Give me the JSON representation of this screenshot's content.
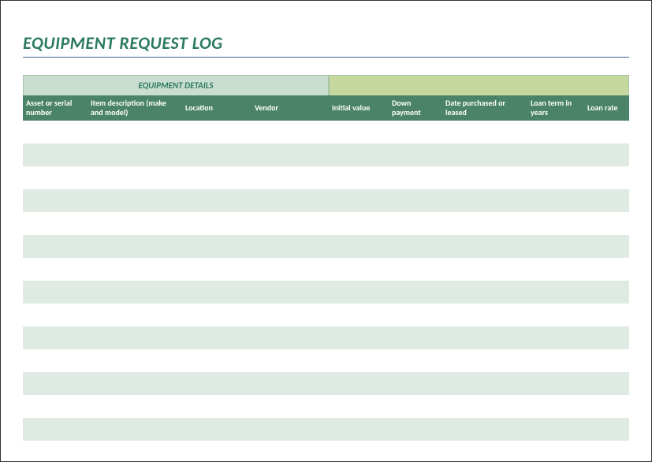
{
  "title": "EQUIPMENT REQUEST LOG",
  "tabs": {
    "left": "EQUIPMENT DETAILS",
    "right": ""
  },
  "columns": [
    "Asset or serial number",
    "Item description (make and model)",
    "Location",
    "Vendor",
    "Initial value",
    "Down payment",
    "Date purchased or leased",
    "Loan term in years",
    "Loan rate"
  ],
  "rows": [
    [
      "",
      "",
      "",
      "",
      "",
      "",
      "",
      "",
      ""
    ],
    [
      "",
      "",
      "",
      "",
      "",
      "",
      "",
      "",
      ""
    ],
    [
      "",
      "",
      "",
      "",
      "",
      "",
      "",
      "",
      ""
    ],
    [
      "",
      "",
      "",
      "",
      "",
      "",
      "",
      "",
      ""
    ],
    [
      "",
      "",
      "",
      "",
      "",
      "",
      "",
      "",
      ""
    ],
    [
      "",
      "",
      "",
      "",
      "",
      "",
      "",
      "",
      ""
    ],
    [
      "",
      "",
      "",
      "",
      "",
      "",
      "",
      "",
      ""
    ],
    [
      "",
      "",
      "",
      "",
      "",
      "",
      "",
      "",
      ""
    ],
    [
      "",
      "",
      "",
      "",
      "",
      "",
      "",
      "",
      ""
    ],
    [
      "",
      "",
      "",
      "",
      "",
      "",
      "",
      "",
      ""
    ],
    [
      "",
      "",
      "",
      "",
      "",
      "",
      "",
      "",
      ""
    ],
    [
      "",
      "",
      "",
      "",
      "",
      "",
      "",
      "",
      ""
    ],
    [
      "",
      "",
      "",
      "",
      "",
      "",
      "",
      "",
      ""
    ],
    [
      "",
      "",
      "",
      "",
      "",
      "",
      "",
      "",
      ""
    ]
  ]
}
